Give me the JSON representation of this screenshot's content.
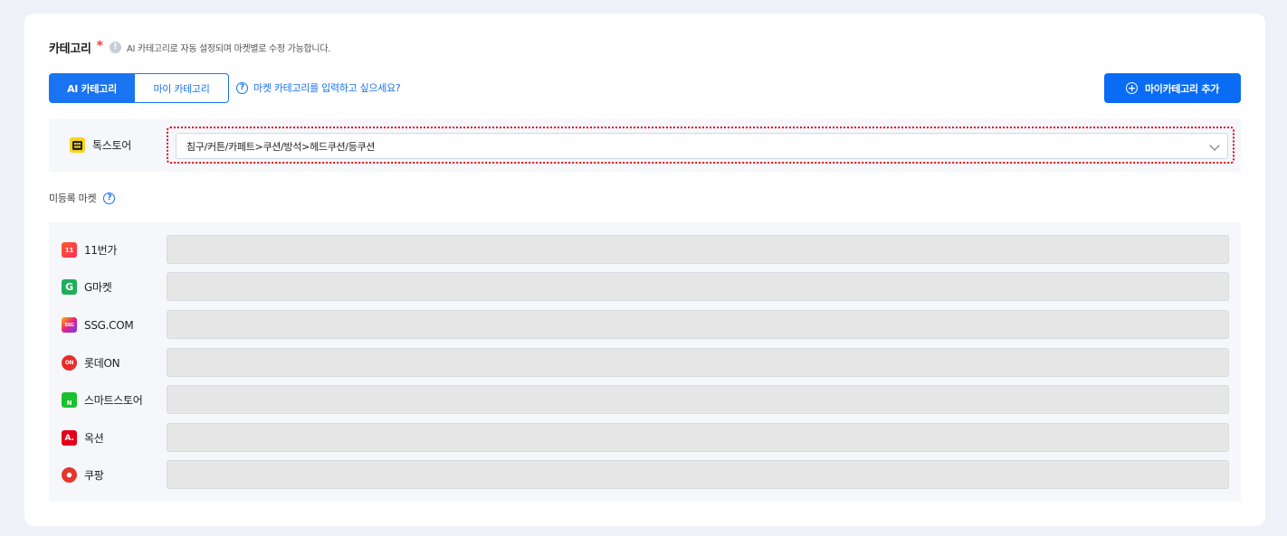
{
  "header": {
    "title": "카테고리",
    "required_mark": "*",
    "info_glyph": "!",
    "hint": "AI 카테고리로 자동 설정되며 마켓별로 수정 가능합니다."
  },
  "tabs": [
    {
      "label": "AI 카테고리",
      "active": true
    },
    {
      "label": "마이 카테고리",
      "active": false
    }
  ],
  "help_link": {
    "glyph": "?",
    "text": "마켓 카테고리를 입력하고 싶으세요?"
  },
  "add_button": {
    "glyph": "+",
    "label": "마이카테고리 추가"
  },
  "registered": {
    "market": "톡스토어",
    "logo_color": "#f7d51d",
    "selected_category": "침구/커튼/카페트>쿠션/방석>헤드쿠션/등쿠션"
  },
  "unregistered": {
    "label": "미등록 마켓",
    "help_glyph": "?",
    "markets": [
      {
        "name": "11번가",
        "logo_text": "11",
        "logo_color": "#ff3d2e"
      },
      {
        "name": "G마켓",
        "logo_text": "G",
        "logo_color": "#1fae5b"
      },
      {
        "name": "SSG.COM",
        "logo_text": "SSG",
        "logo_color": "#e7217e"
      },
      {
        "name": "롯데ON",
        "logo_text": "ON",
        "logo_color": "#ea2b2b"
      },
      {
        "name": "스마트스토어",
        "logo_text": "N",
        "logo_color": "#19c02f"
      },
      {
        "name": "옥션",
        "logo_text": "A.",
        "logo_color": "#e4001b"
      },
      {
        "name": "쿠팡",
        "logo_text": "",
        "logo_color": "#e4362b"
      }
    ]
  },
  "colors": {
    "accent": "#0a6cf5",
    "highlight_border": "#e0001b"
  }
}
